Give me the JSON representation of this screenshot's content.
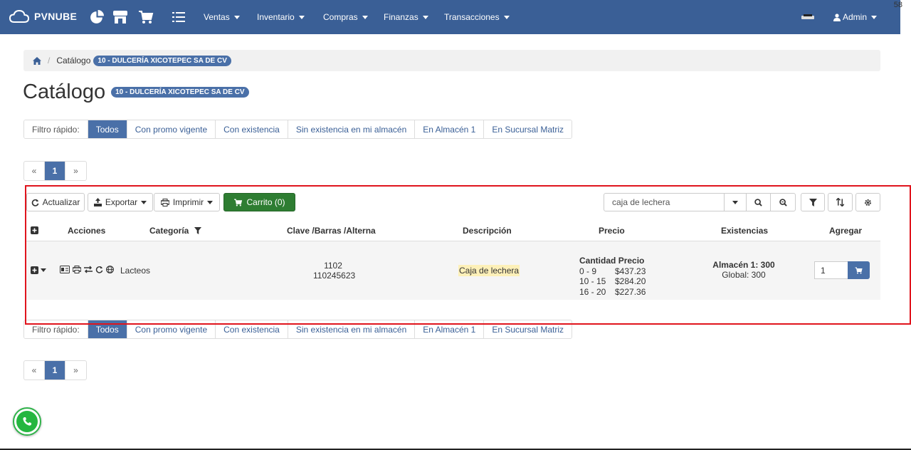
{
  "navbar": {
    "brand": "PVNUBE",
    "menus": [
      "Ventas",
      "Inventario",
      "Compras",
      "Finanzas",
      "Transacciones"
    ],
    "user": "Admin",
    "counter": "58",
    "icons": [
      "pie-chart-icon",
      "store-icon",
      "cart-icon",
      "list-icon"
    ]
  },
  "breadcrumb": {
    "home_icon": "home-icon",
    "label": "Catálogo",
    "badge": "10 - DULCERÍA XICOTEPEC SA DE CV"
  },
  "page": {
    "title": "Catálogo",
    "badge": "10 - DULCERÍA XICOTEPEC SA DE CV"
  },
  "filters": {
    "label": "Filtro rápido:",
    "items": [
      "Todos",
      "Con promo vigente",
      "Con existencia",
      "Sin existencia en mi almacén",
      "En Almacén 1",
      "En Sucursal Matriz"
    ],
    "active": "Todos"
  },
  "pager": {
    "prev": "«",
    "current": "1",
    "next": "»"
  },
  "toolbar": {
    "refresh": "Actualizar",
    "export": "Exportar",
    "print": "Imprimir",
    "cart": "Carrito (0)",
    "search_value": "caja de lechera"
  },
  "table": {
    "headers": {
      "acciones": "Acciones",
      "categoria": "Categoría",
      "clave": "Clave /Barras /Alterna",
      "descripcion": "Descripción",
      "precio": "Precio",
      "existencias": "Existencias",
      "agregar": "Agregar"
    },
    "row": {
      "categoria": "Lacteos",
      "clave": "1102",
      "barras": "110245623",
      "descripcion": "Caja de lechera",
      "price_header_qty": "Cantidad",
      "price_header_price": "Precio",
      "prices": [
        {
          "range": "0 - 9",
          "price": "$437.23"
        },
        {
          "range": "10 - 15",
          "price": "$284.20"
        },
        {
          "range": "16 - 20",
          "price": "$227.36"
        }
      ],
      "almacen": "Almacén 1: 300",
      "global": "Global: 300",
      "qty": "1"
    }
  },
  "colors": {
    "primary": "#3a5f96",
    "accent": "#4a70a8",
    "cart_green": "#2e7d32",
    "highlight": "#e0141d"
  }
}
